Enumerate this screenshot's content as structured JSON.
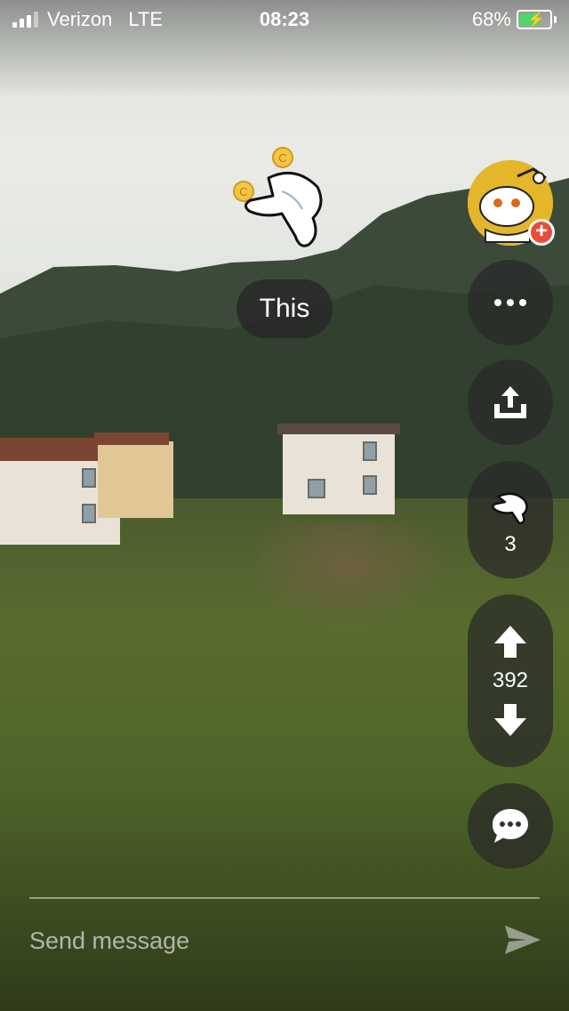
{
  "status_bar": {
    "carrier": "Verizon",
    "network": "LTE",
    "time": "08:23",
    "battery_percent": "68%",
    "battery_level": 0.68,
    "charging": true
  },
  "award": {
    "tooltip_text": "This"
  },
  "rail": {
    "awards_count": "3",
    "vote_score": "392"
  },
  "message": {
    "placeholder": "Send message"
  },
  "icons": {
    "signal": "signal-icon",
    "battery": "battery-charging-icon",
    "more": "more-dots-icon",
    "share": "share-icon",
    "award": "award-hand-icon",
    "upvote": "arrow-up-icon",
    "downvote": "arrow-down-icon",
    "comments": "comment-bubble-icon",
    "send": "send-arrow-icon"
  },
  "colors": {
    "avatar_bg": "#e4b62a",
    "plus_badge": "#ea4c3a",
    "battery_fill": "#4cd964"
  }
}
